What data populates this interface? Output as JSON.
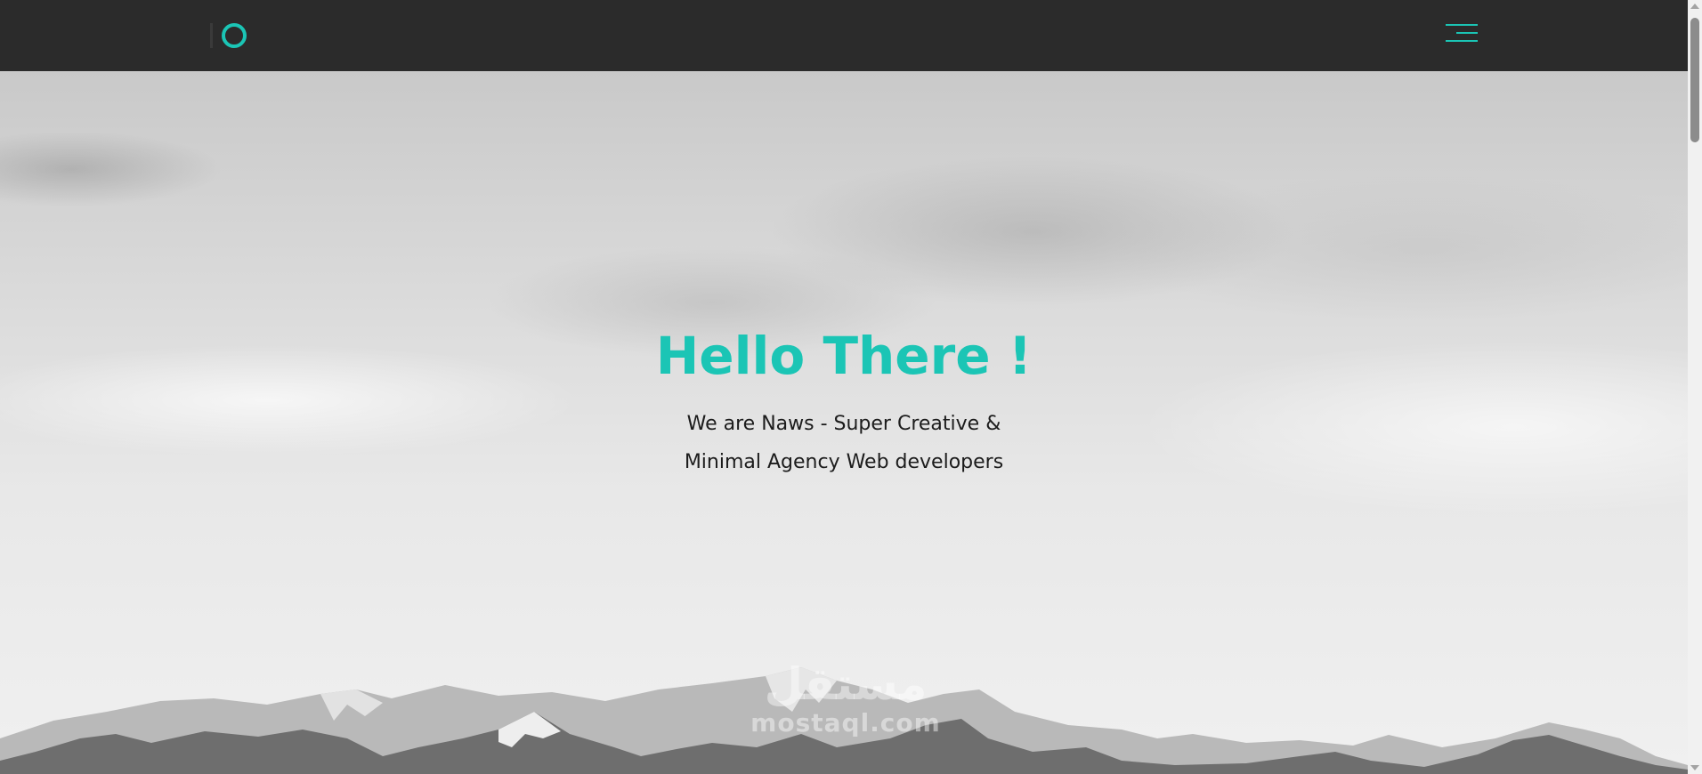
{
  "navbar": {
    "logo_icon": "ring-logo-icon",
    "menu_icon": "hamburger-menu-icon"
  },
  "hero": {
    "title": "Hello There !",
    "subtitle_line1": "We are Naws - Super Creative &",
    "subtitle_line2": "Minimal Agency Web developers"
  },
  "watermark": {
    "arabic": "مستقل",
    "latin": "mostaql.com"
  },
  "colors": {
    "accent": "#1bc5b5",
    "navbar_bg": "#2b2b2b",
    "text": "#1c1c1c"
  }
}
